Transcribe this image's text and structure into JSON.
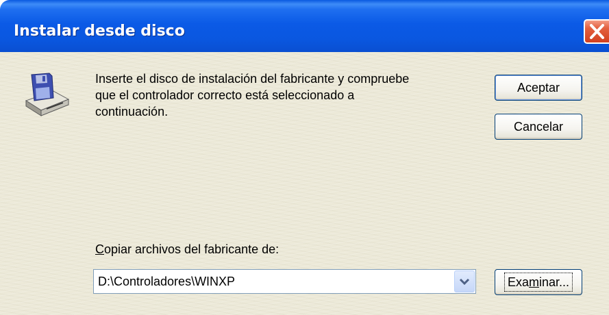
{
  "window": {
    "title": "Instalar desde disco"
  },
  "message": {
    "line1": "Inserte el disco de instalación del fabricante y compruebe",
    "line2": "que el controlador correcto está seleccionado a",
    "line3": "continuación."
  },
  "buttons": {
    "accept": "Aceptar",
    "cancel": "Cancelar",
    "browse_prefix": "Exa",
    "browse_accel": "m",
    "browse_suffix": "inar..."
  },
  "copy_from": {
    "label_accel": "C",
    "label_rest": "opiar archivos del fabricante de:",
    "value": "D:\\Controladores\\WINXP"
  },
  "icons": {
    "close": "close-icon",
    "disk": "floppy-disk-drive-icon",
    "dropdown": "chevron-down-icon"
  }
}
